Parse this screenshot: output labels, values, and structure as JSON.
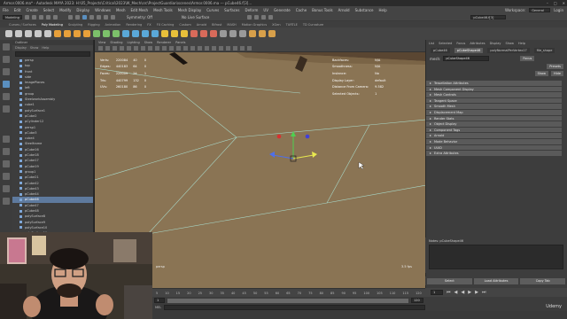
{
  "window": {
    "title": "Armor.0006.ma* - Autodesk MAYA 2023: H:\\05_Projects\\Critical\\2023\\W_Mech\\src\\ProjectGuardian\\scenes\\Armor.0006.ma --- pCube46.f[3]..."
  },
  "menubar": {
    "items": [
      "File",
      "Edit",
      "Create",
      "Select",
      "Modify",
      "Display",
      "Windows",
      "Mesh",
      "Edit Mesh",
      "Mesh Tools",
      "Mesh Display",
      "Curves",
      "Surfaces",
      "Deform",
      "UV",
      "Generate",
      "Cache",
      "Bonus Tools",
      "Arnold",
      "Substance",
      "Help"
    ],
    "workspace_label": "Workspace:",
    "workspace_value": "General",
    "login_label": "Login"
  },
  "statusline": {
    "mode": "Modeling",
    "live_surface": "No Live Surface",
    "symmetry": "Symmetry: Off",
    "search_value": "pCube46.f[3]"
  },
  "shelf": {
    "tabs": [
      "Curves / Surfaces",
      "Poly Modeling",
      "Sculpting",
      "Rigging",
      "Animation",
      "Rendering",
      "FX",
      "FX Caching",
      "Custom",
      "Arnold",
      "Bifrost",
      "MASH",
      "Motion Graphics",
      "XGen",
      "TURTLE",
      "TD Curvature"
    ]
  },
  "outliner": {
    "title": "Outliner",
    "menu": [
      "Display",
      "Show",
      "Help"
    ],
    "items": [
      {
        "label": "persp",
        "selected": false
      },
      {
        "label": "top",
        "selected": false
      },
      {
        "label": "front",
        "selected": false
      },
      {
        "label": "side",
        "selected": false
      },
      {
        "label": "ImagePlanes",
        "selected": false
      },
      {
        "label": "left",
        "selected": false
      },
      {
        "label": "group",
        "selected": false
      },
      {
        "label": "SteelworkAssembly",
        "selected": false
      },
      {
        "label": "cube1",
        "selected": false
      },
      {
        "label": "polySurface1",
        "selected": false
      },
      {
        "label": "pCube2",
        "selected": false
      },
      {
        "label": "pCylinder12",
        "selected": false
      },
      {
        "label": "persp1",
        "selected": false
      },
      {
        "label": "pCube3",
        "selected": false
      },
      {
        "label": "cube4",
        "selected": false
      },
      {
        "label": "Steelframe",
        "selected": false
      },
      {
        "label": "pCube16",
        "selected": false
      },
      {
        "label": "pCube18",
        "selected": false
      },
      {
        "label": "pCube17",
        "selected": false
      },
      {
        "label": "pCube19",
        "selected": false
      },
      {
        "label": "group1",
        "selected": false
      },
      {
        "label": "pCube21",
        "selected": false
      },
      {
        "label": "pCube42",
        "selected": false
      },
      {
        "label": "pCube43",
        "selected": false
      },
      {
        "label": "pCube44",
        "selected": false
      },
      {
        "label": "pCube46",
        "selected": true
      },
      {
        "label": "pCube47",
        "selected": false
      },
      {
        "label": "pCube48",
        "selected": false
      },
      {
        "label": "polySurface8",
        "selected": false
      },
      {
        "label": "polySurface9",
        "selected": false
      },
      {
        "label": "polySurface10",
        "selected": false
      },
      {
        "label": "polySurface11",
        "selected": false
      },
      {
        "label": "polySurface12",
        "selected": false
      }
    ]
  },
  "viewport": {
    "menu": [
      "View",
      "Shading",
      "Lighting",
      "Show",
      "Renderer",
      "Panels"
    ],
    "hud_left": [
      {
        "label": "Verts:",
        "a": "220084",
        "b": "40",
        "c": "0"
      },
      {
        "label": "Edges:",
        "a": "440183",
        "b": "64",
        "c": "0"
      },
      {
        "label": "Faces:",
        "a": "220009",
        "b": "24",
        "c": "1"
      },
      {
        "label": "Tris:",
        "a": "440799",
        "b": "132",
        "c": "0"
      },
      {
        "label": "UVs:",
        "a": "260180",
        "b": "86",
        "c": "0"
      }
    ],
    "hud_right": [
      {
        "label": "Backfaces:",
        "value": "N/A"
      },
      {
        "label": "Smoothness:",
        "value": "N/A"
      },
      {
        "label": "Instance:",
        "value": "No"
      },
      {
        "label": "Display Layer:",
        "value": "default"
      },
      {
        "label": "Distance From Camera:",
        "value": "9.582"
      },
      {
        "label": "Selected Objects:",
        "value": "1"
      }
    ],
    "camera_label": "persp",
    "fps_label": "3.5 fps"
  },
  "timeline": {
    "ticks": [
      "5",
      "10",
      "15",
      "20",
      "25",
      "30",
      "35",
      "40",
      "45",
      "50",
      "55",
      "60",
      "65",
      "70",
      "75",
      "80",
      "85",
      "90",
      "95",
      "100",
      "105",
      "110",
      "115",
      "120"
    ],
    "start": "1",
    "end": "120",
    "current": "1"
  },
  "attribute_editor": {
    "tabs": [
      "List",
      "Selected",
      "Focus",
      "Attributes",
      "Display",
      "Show",
      "Help"
    ],
    "node_tabs": [
      "pCube46",
      "pCubeShape46",
      "polyNormalPerVertex17",
      "file_shape"
    ],
    "shape_label": "mesh:",
    "shape_value": "pCubeShape46",
    "focus_button": "Focus",
    "presets_button": "Presets",
    "show_button": "Show",
    "hide_button": "Hide",
    "sections": [
      "Tessellation Attributes",
      "Mesh Component Display",
      "Mesh Controls",
      "Tangent Space",
      "Smooth Mesh",
      "Displacement Map",
      "Render Stats",
      "Object Display",
      "Component Tags",
      "Arnold",
      "Mode Behavior",
      "UUID",
      "Extra Attributes"
    ],
    "notes_label": "Notes: pCubeShape46",
    "buttons": [
      "Select",
      "Load Attributes",
      "Copy Tab"
    ]
  },
  "watermark": "Udemy",
  "colors": {
    "viewport": "#8a7454",
    "selection": "#5e7a9e",
    "wire": "#a8d8c8"
  }
}
